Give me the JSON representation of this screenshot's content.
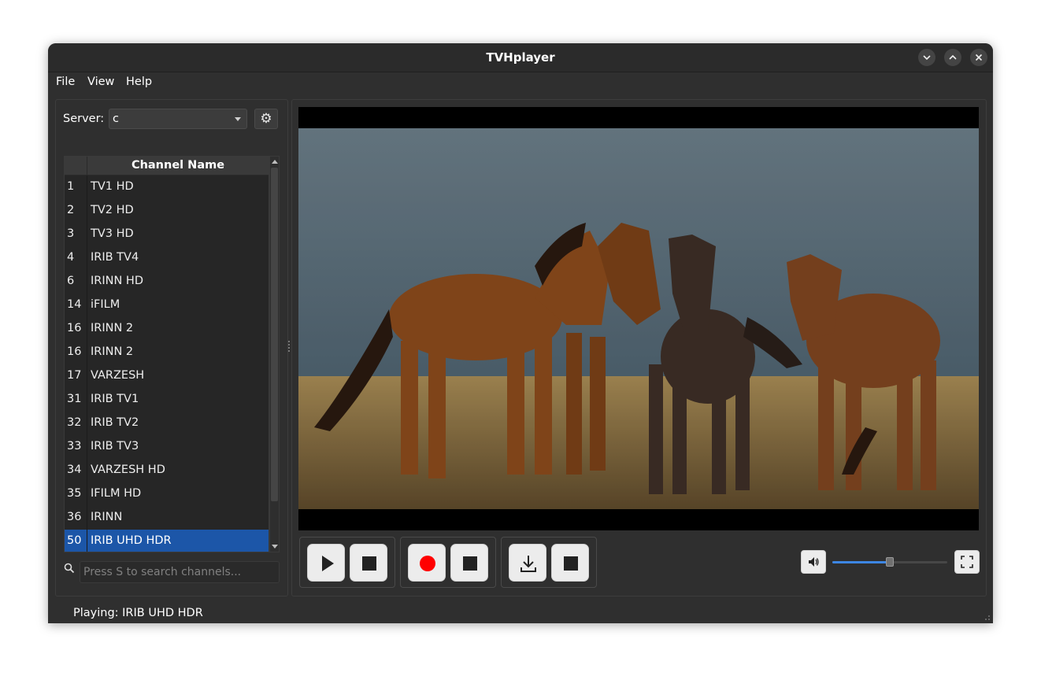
{
  "window": {
    "title": "TVHplayer"
  },
  "menu": {
    "items": [
      "File",
      "View",
      "Help"
    ]
  },
  "server": {
    "label": "Server:",
    "value": "c"
  },
  "table": {
    "header": "Channel Name",
    "rows": [
      {
        "num": "1",
        "name": "TV1 HD"
      },
      {
        "num": "2",
        "name": "TV2 HD"
      },
      {
        "num": "3",
        "name": "TV3 HD"
      },
      {
        "num": "4",
        "name": "IRIB TV4"
      },
      {
        "num": "6",
        "name": "IRINN HD"
      },
      {
        "num": "14",
        "name": "iFILM"
      },
      {
        "num": "16",
        "name": "IRINN 2"
      },
      {
        "num": "16",
        "name": "IRINN 2"
      },
      {
        "num": "17",
        "name": "VARZESH"
      },
      {
        "num": "31",
        "name": "IRIB TV1"
      },
      {
        "num": "32",
        "name": "IRIB TV2"
      },
      {
        "num": "33",
        "name": "IRIB TV3"
      },
      {
        "num": "34",
        "name": "VARZESH HD"
      },
      {
        "num": "35",
        "name": "IFILM HD"
      },
      {
        "num": "36",
        "name": "IRINN"
      },
      {
        "num": "50",
        "name": "IRIB UHD HDR"
      }
    ],
    "selected_index": 15
  },
  "search": {
    "placeholder": "Press S to search channels..."
  },
  "controls": {
    "volume_level": 0.5,
    "record_color": "#ff0000",
    "accent_color": "#1c56a8",
    "icons": [
      "play-icon",
      "stop-icon",
      "record-icon",
      "download-icon",
      "speaker-icon",
      "fullscreen-icon",
      "gear-icon",
      "search-icon"
    ]
  },
  "status": {
    "text": "Playing: IRIB UHD HDR"
  }
}
